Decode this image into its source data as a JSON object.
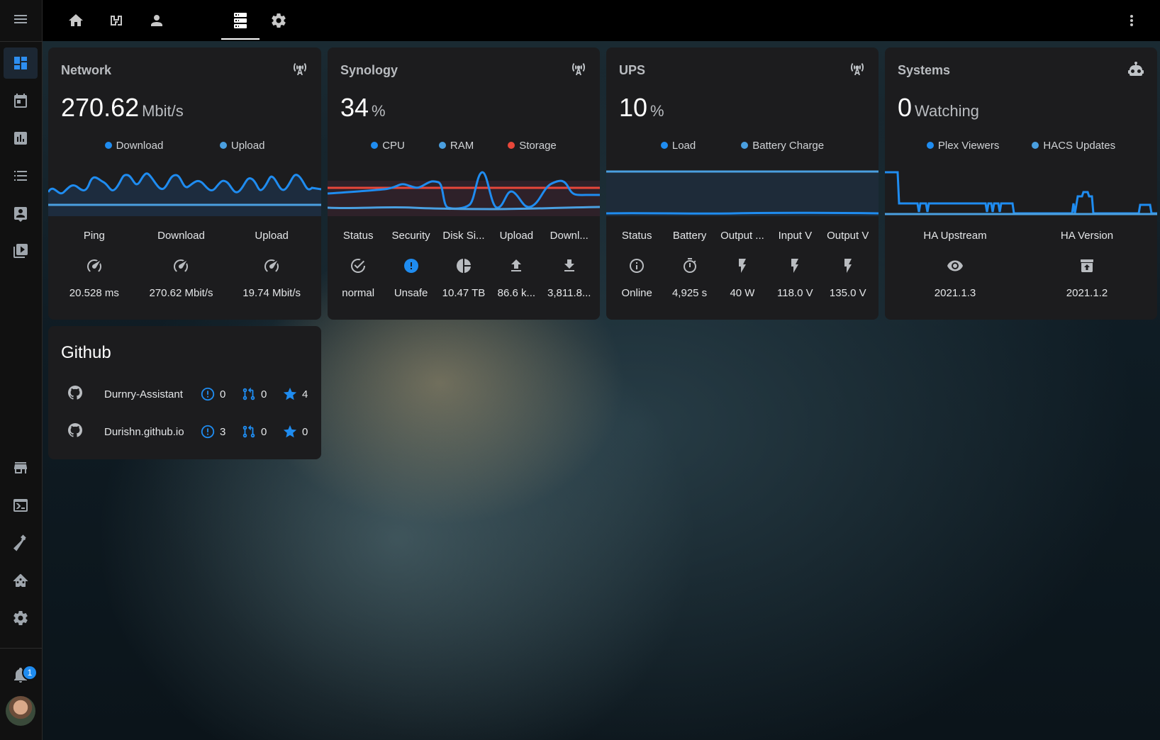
{
  "colors": {
    "accent": "#1f8cf0",
    "upload_series": "#4a9fe0",
    "storage_series": "#e8473a",
    "card_bg": "#1c1c1e"
  },
  "sidebar": {
    "items": [
      {
        "icon": "menu-icon"
      },
      {
        "icon": "dashboard-icon",
        "active": true
      },
      {
        "icon": "calendar-icon"
      },
      {
        "icon": "chart-box-icon"
      },
      {
        "icon": "list-icon"
      },
      {
        "icon": "account-box-icon"
      },
      {
        "icon": "play-box-multiple-icon"
      },
      {
        "icon": "store-icon"
      },
      {
        "icon": "console-icon"
      },
      {
        "icon": "hammer-icon"
      },
      {
        "icon": "home-assistant-icon"
      },
      {
        "icon": "cog-icon"
      }
    ],
    "notifications_count": "1"
  },
  "topbar": {
    "tabs": [
      {
        "icon": "home-icon"
      },
      {
        "icon": "floor-plan-icon"
      },
      {
        "icon": "account-icon"
      },
      {
        "icon": "server-icon",
        "active": true
      },
      {
        "icon": "cog-icon"
      }
    ],
    "overflow_icon": "dots-vertical-icon"
  },
  "cards": {
    "network": {
      "title": "Network",
      "value": "270.62",
      "unit": "Mbit/s",
      "corner_icon": "antenna-icon",
      "legend": [
        "Download",
        "Upload"
      ],
      "stats": [
        {
          "label": "Ping",
          "icon": "speedometer-icon",
          "value": "20.528 ms"
        },
        {
          "label": "Download",
          "icon": "speedometer-icon",
          "value": "270.62 Mbit/s"
        },
        {
          "label": "Upload",
          "icon": "speedometer-icon",
          "value": "19.74 Mbit/s"
        }
      ]
    },
    "synology": {
      "title": "Synology",
      "value": "34",
      "unit": "%",
      "corner_icon": "antenna-icon",
      "legend": [
        "CPU",
        "RAM",
        "Storage"
      ],
      "stats": [
        {
          "label": "Status",
          "icon": "check-circle-outline-icon",
          "value": "normal"
        },
        {
          "label": "Security",
          "icon": "alert-circle-icon",
          "value": "Unsafe"
        },
        {
          "label": "Disk Si...",
          "icon": "chart-pie-icon",
          "value": "10.47 TB"
        },
        {
          "label": "Upload",
          "icon": "upload-icon",
          "value": "86.6 k..."
        },
        {
          "label": "Downl...",
          "icon": "download-icon",
          "value": "3,811.8..."
        }
      ]
    },
    "ups": {
      "title": "UPS",
      "value": "10",
      "unit": "%",
      "corner_icon": "antenna-icon",
      "legend": [
        "Load",
        "Battery Charge"
      ],
      "stats": [
        {
          "label": "Status",
          "icon": "information-outline-icon",
          "value": "Online"
        },
        {
          "label": "Battery",
          "icon": "timer-outline-icon",
          "value": "4,925 s"
        },
        {
          "label": "Output ...",
          "icon": "flash-icon",
          "value": "40 W"
        },
        {
          "label": "Input V",
          "icon": "flash-icon",
          "value": "118.0 V"
        },
        {
          "label": "Output V",
          "icon": "flash-icon",
          "value": "135.0 V"
        }
      ]
    },
    "systems": {
      "title": "Systems",
      "value": "0",
      "unit": "Watching",
      "corner_icon": "robot-icon",
      "legend": [
        "Plex Viewers",
        "HACS Updates"
      ],
      "stats": [
        {
          "label": "HA Upstream",
          "icon": "eye-icon",
          "value": "2021.1.3"
        },
        {
          "label": "HA Version",
          "icon": "package-up-icon",
          "value": "2021.1.2"
        }
      ]
    },
    "github": {
      "title": "Github",
      "repos": [
        {
          "name": "Durnry-Assistant",
          "issues": "0",
          "pull_requests": "0",
          "stars": "4"
        },
        {
          "name": "Durishn.github.io",
          "issues": "3",
          "pull_requests": "0",
          "stars": "0"
        }
      ]
    }
  }
}
